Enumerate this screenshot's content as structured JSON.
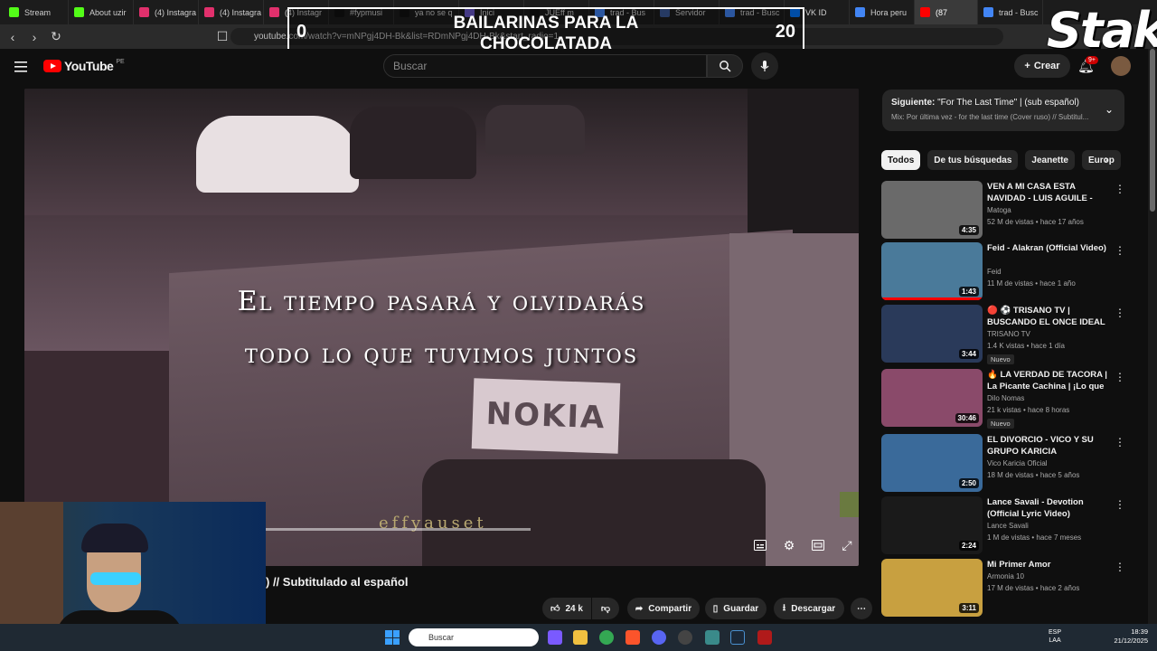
{
  "browser": {
    "tabs": [
      {
        "label": "Stream",
        "color": "#53fc18"
      },
      {
        "label": "About uzir",
        "color": "#53fc18"
      },
      {
        "label": "(4) Instagra",
        "color": "#e1306c"
      },
      {
        "label": "(4) Instagra",
        "color": "#e1306c"
      },
      {
        "label": "(4) Instagr",
        "color": "#e1306c"
      },
      {
        "label": "#fypmusi",
        "color": "#111111"
      },
      {
        "label": "ya no se q",
        "color": "#111111"
      },
      {
        "label": "Inici",
        "color": "#6a5acd"
      },
      {
        "label": "JUEff m",
        "color": "#111111"
      },
      {
        "label": "trad - Bus",
        "color": "#4285f4"
      },
      {
        "label": "Servidor",
        "color": "#3b5998"
      },
      {
        "label": "trad - Busc",
        "color": "#4285f4"
      },
      {
        "label": "VK ID",
        "color": "#0077ff"
      },
      {
        "label": "Hora peru",
        "color": "#4285f4"
      },
      {
        "label": "(87",
        "color": "#ff0000",
        "active": true
      },
      {
        "label": "trad - Busc",
        "color": "#4285f4"
      }
    ],
    "url": "youtube.com/watch?v=mNPgj4DH-Bk&list=RDmNPgj4DH-Bk&start_radio=1"
  },
  "overlay": {
    "score_left": "0",
    "score_right": "20",
    "title": "BAILARINAS PARA LA CHOCOLATADA",
    "brand": "Stake"
  },
  "youtube": {
    "logo_text": "YouTube",
    "country_code": "PE",
    "search_placeholder": "Buscar",
    "create_label": "Crear",
    "notifications_badge": "9+"
  },
  "video": {
    "subtitle_line1": "El tiempo pasará y olvidarás",
    "subtitle_line2": "todo lo que tuvimos juntos",
    "sign_text": "NOKIA",
    "watermark": "effyauset",
    "title": ") // Subtitulado al español",
    "likes": "24 k",
    "share_label": "Compartir",
    "save_label": "Guardar",
    "download_label": "Descargar"
  },
  "sidebar": {
    "next_prefix": "Siguiente:",
    "next_title": "\"For The Last Time\" | (sub español)",
    "next_sub": "Mix: Por última vez - for the last time (Cover ruso) // Subtitul...",
    "chips": [
      "Todos",
      "De tus búsquedas",
      "Jeanette",
      "Europ"
    ],
    "recommendations": [
      {
        "title": "VEN A MI CASA ESTA NAVIDAD - LUIS AGUILE -",
        "channel": "Matoga",
        "meta": "52 M de vistas • hace 17 años",
        "duration": "4:35",
        "thumb": "#6a6a6a",
        "new": false
      },
      {
        "title": "Feid - Alakran (Official Video)",
        "channel": "Feid",
        "meta": "11 M de vistas • hace 1 año",
        "duration": "1:43",
        "thumb": "#4a7a9a",
        "new": false
      },
      {
        "title": "🔴 ⚽ TRISANO TV | BUSCANDO EL ONCE IDEAL D...",
        "channel": "TRISANO TV",
        "meta": "1.4 K vistas • hace 1 día",
        "duration": "3:44",
        "thumb": "#2a3a5a",
        "new": true
      },
      {
        "title": "🔥 LA VERDAD DE TACORA | La Picante Cachina | ¡Lo que nunc...",
        "channel": "Dilo Nomas",
        "meta": "21 k vistas • hace 8 horas",
        "duration": "30:46",
        "thumb": "#8a4a6a",
        "new": true
      },
      {
        "title": "EL DIVORCIO - VICO Y SU GRUPO KARICIA",
        "channel": "Vico Karicia Oficial",
        "meta": "18 M de vistas • hace 5 años",
        "duration": "2:50",
        "thumb": "#3a6a9a",
        "new": false
      },
      {
        "title": "Lance Savali - Devotion (Official Lyric Video)",
        "channel": "Lance Savali",
        "meta": "1 M de vistas • hace 7 meses",
        "duration": "2:24",
        "thumb": "#1a1a1a",
        "new": false
      },
      {
        "title": "Mi Primer Amor",
        "channel": "Armonia 10",
        "meta": "17 M de vistas • hace 2 años",
        "duration": "3:11",
        "thumb": "#c8a040",
        "new": false
      }
    ],
    "new_label": "Nuevo"
  },
  "taskbar": {
    "search_placeholder": "Buscar",
    "lang_line1": "ESP",
    "lang_line2": "LAA",
    "time": "18:39",
    "date": "21/12/2025"
  }
}
